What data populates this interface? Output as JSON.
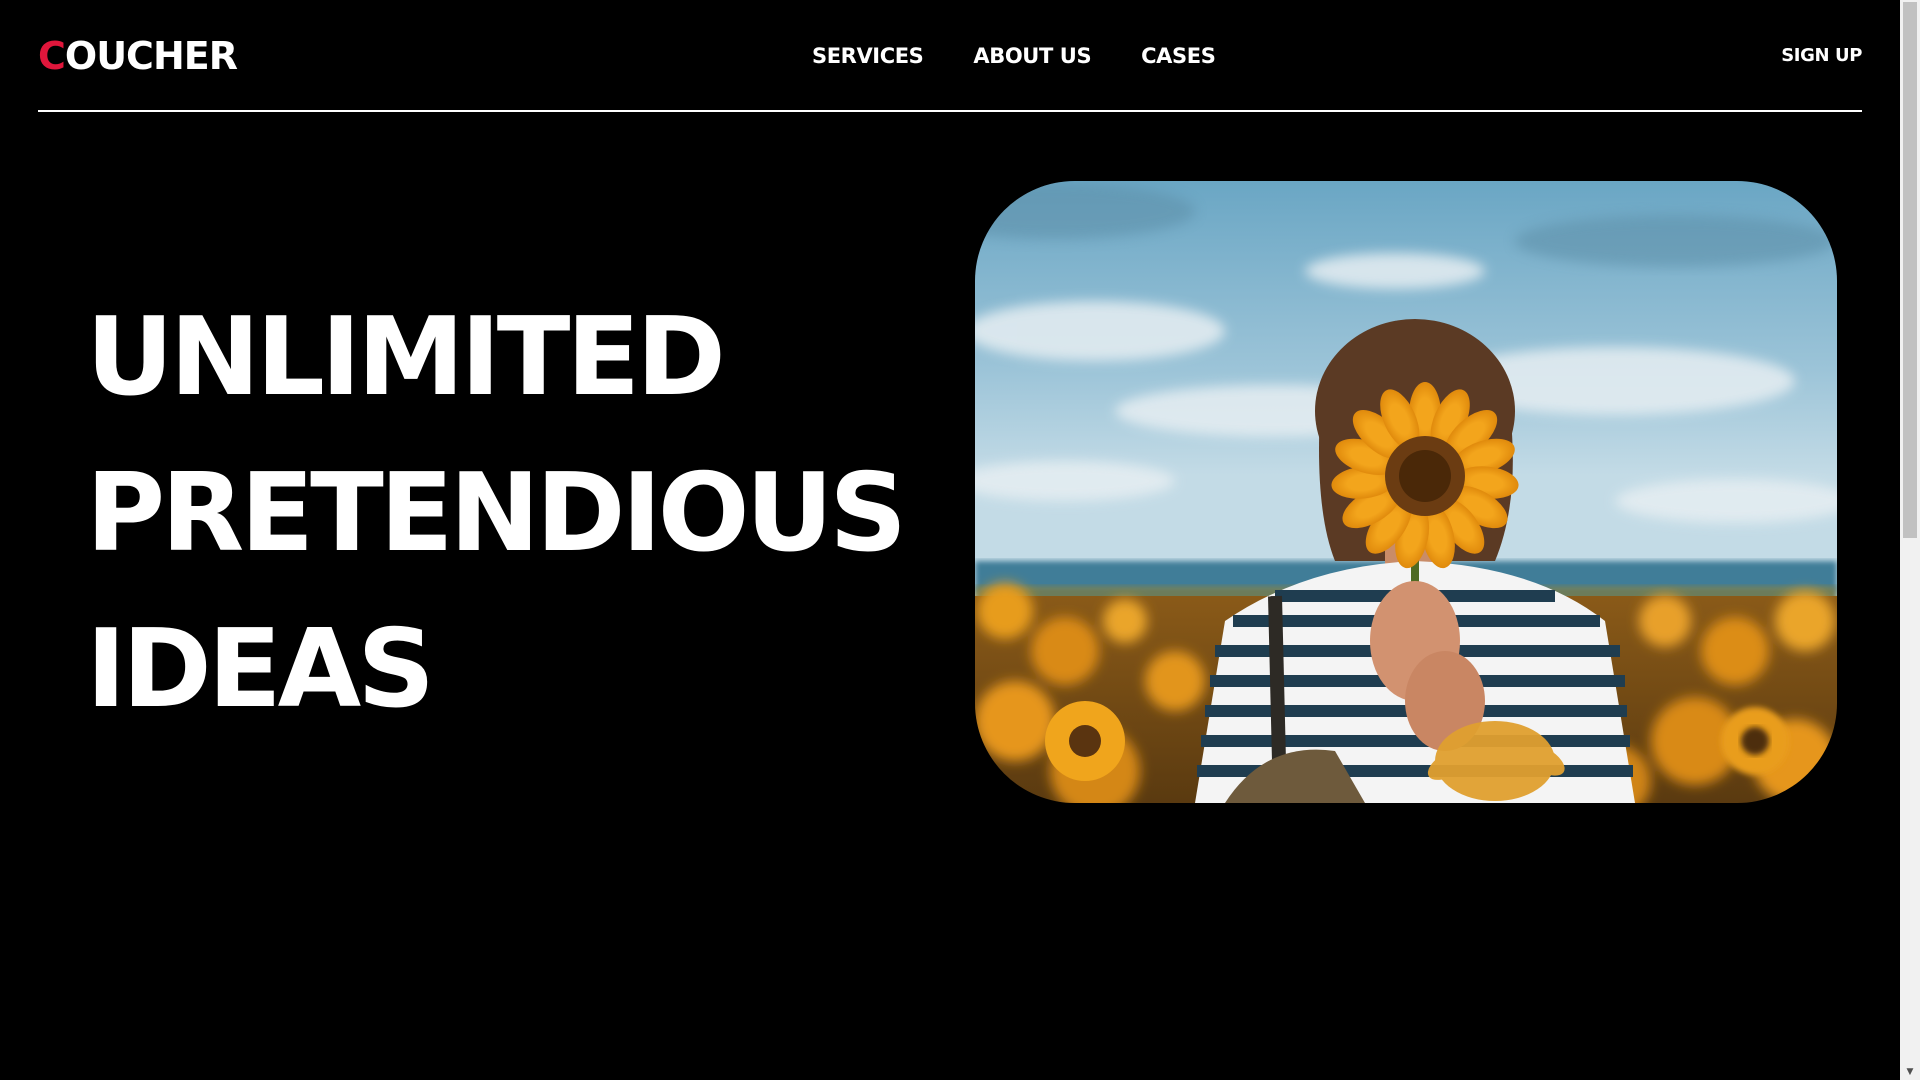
{
  "brand": {
    "logo_first_letter": "C",
    "logo_rest": "OUCHER",
    "accent_color": "#e0163b"
  },
  "nav": {
    "items": [
      {
        "label": "SERVICES"
      },
      {
        "label": "ABOUT US"
      },
      {
        "label": "CASES"
      }
    ],
    "signup_label": "SIGN UP"
  },
  "hero": {
    "title_lines": [
      "UNLIMITED",
      "PRETENDIOUS",
      "IDEAS"
    ],
    "image_subject": "woman holding a sunflower in front of her face in a sunflower field"
  },
  "colors": {
    "background": "#000000",
    "text": "#ffffff",
    "accent": "#e0163b"
  },
  "icons": {
    "scroll_down": "chevron-down-icon"
  }
}
